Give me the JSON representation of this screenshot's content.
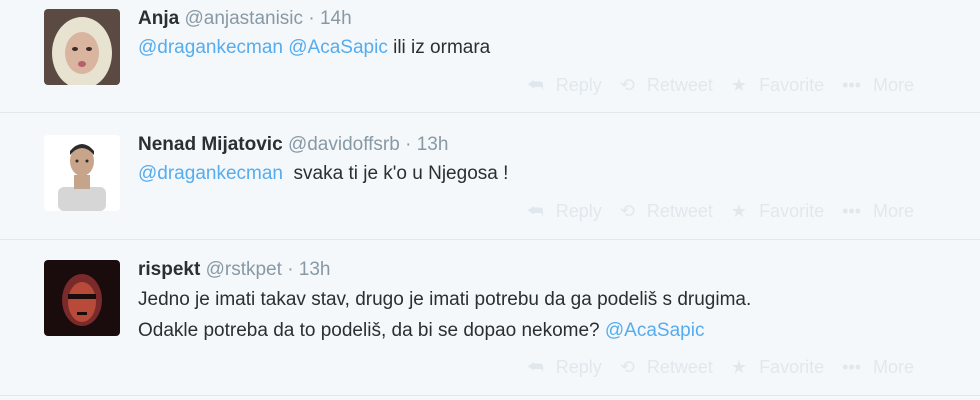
{
  "tweets": [
    {
      "fullname": "Anja",
      "username": "@anjastanisic",
      "dot": "·",
      "time": "14h",
      "body": [
        {
          "text": "@dragankecman",
          "mention": true
        },
        {
          "text": " ",
          "mention": false
        },
        {
          "text": "@AcaSapic",
          "mention": true
        },
        {
          "text": " ili iz ormara",
          "mention": false
        }
      ]
    },
    {
      "fullname": "Nenad Mijatovic",
      "username": "@davidoffsrb",
      "dot": "·",
      "time": "13h",
      "body": [
        {
          "text": "@dragankecman",
          "mention": true
        },
        {
          "text": "  svaka ti je k'o u Njegosa !",
          "mention": false
        }
      ]
    },
    {
      "fullname": "rispekt",
      "username": "@rstkpet",
      "dot": "·",
      "time": "13h",
      "body": [
        {
          "text": "Jedno je imati takav stav, drugo je imati potrebu da ga podeliš s drugima.\nOdakle potreba da to podeliš, da bi se dopao nekome? ",
          "mention": false
        },
        {
          "text": "@AcaSapic",
          "mention": true
        }
      ]
    }
  ],
  "actions": {
    "reply_label": "Reply",
    "retweet_label": "Retweet",
    "favorite_label": "Favorite",
    "more_label": "More"
  },
  "icons": {
    "reply": "reply-icon",
    "retweet": "retweet-icon",
    "favorite": "star-icon",
    "more": "more-icon"
  },
  "colors": {
    "mention": "#55acee",
    "muted": "#8899a6",
    "action_faded": "#e1e8ed",
    "background": "#f5f8fa"
  }
}
